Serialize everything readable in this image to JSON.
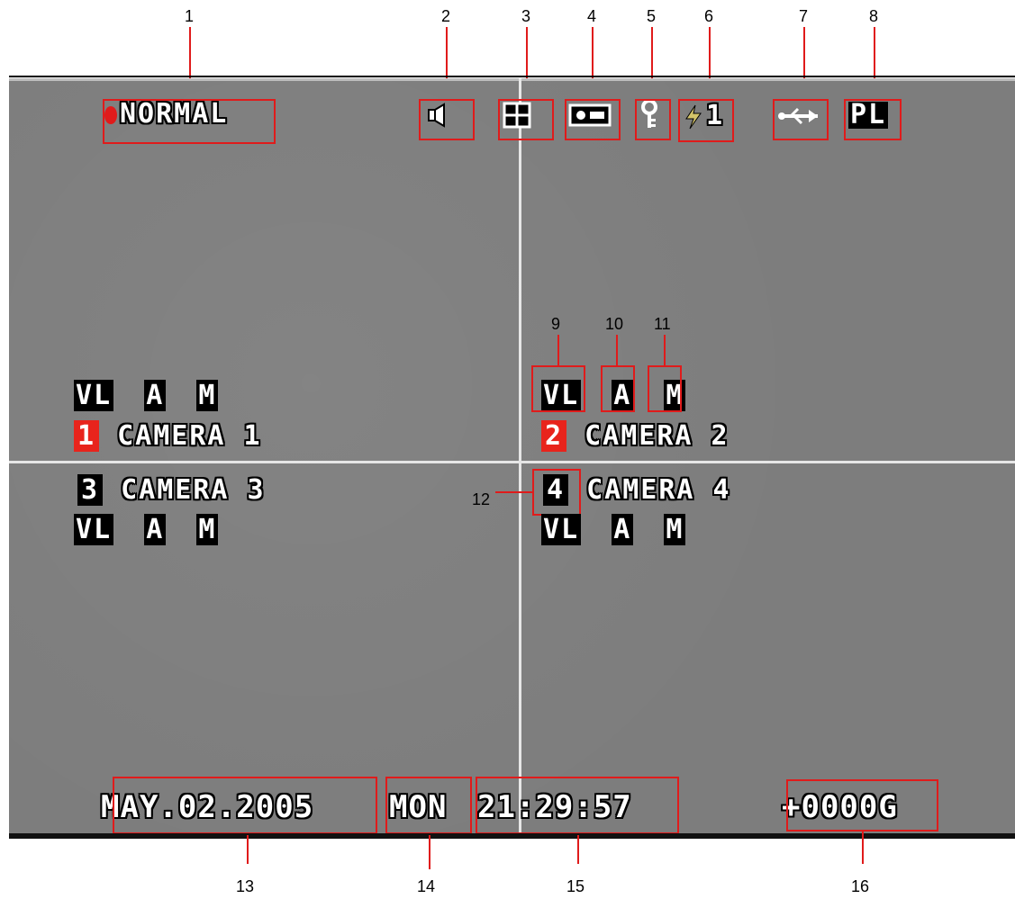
{
  "status": {
    "mode": "NORMAL"
  },
  "top_icons": {
    "audio_icon": "speaker-icon",
    "split_icon": "quad-split-icon",
    "tape_icon": "cassette-icon",
    "key_icon": "key-icon",
    "alarm_value": "1",
    "usb_icon": "usb-icon",
    "playback": "PL"
  },
  "cameras": [
    {
      "num": "1",
      "label": "CAMERA 1",
      "vl": "VL",
      "a": "A",
      "m": "M"
    },
    {
      "num": "2",
      "label": "CAMERA 2",
      "vl": "VL",
      "a": "A",
      "m": "M"
    },
    {
      "num": "3",
      "label": "CAMERA 3",
      "vl": "VL",
      "a": "A",
      "m": "M"
    },
    {
      "num": "4",
      "label": "CAMERA 4",
      "vl": "VL",
      "a": "A",
      "m": "M"
    }
  ],
  "footer": {
    "date": "MAY.02.2005",
    "day": "MON",
    "time": "21:29:57",
    "hdd": "+0000G"
  },
  "callouts": [
    "1",
    "2",
    "3",
    "4",
    "5",
    "6",
    "7",
    "8",
    "9",
    "10",
    "11",
    "12",
    "13",
    "14",
    "15",
    "16"
  ],
  "colors": {
    "screen": "#7d7d7d",
    "callout": "#e01b1b",
    "active_camera": "#e8241c"
  }
}
